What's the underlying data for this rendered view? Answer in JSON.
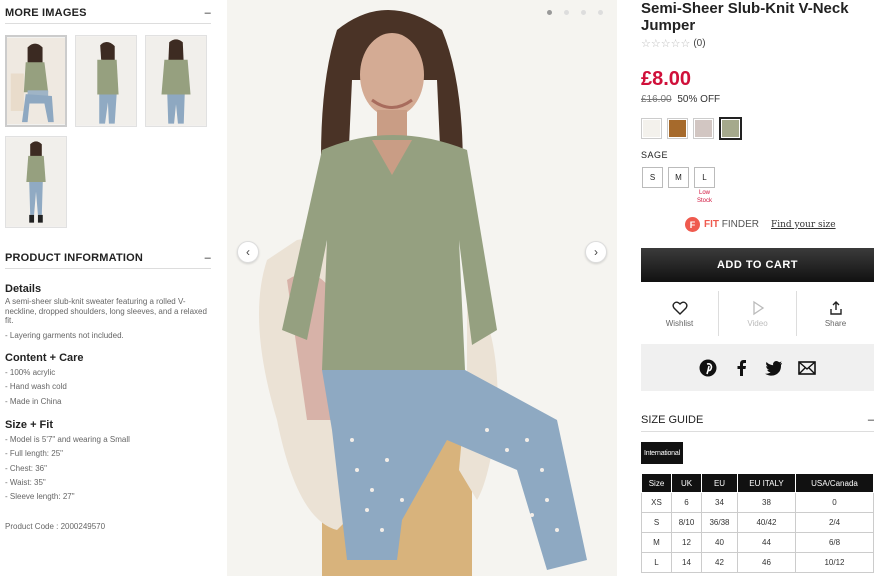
{
  "sidebar": {
    "more_images_title": "MORE IMAGES",
    "more_images_toggle": "–",
    "product_info_title": "PRODUCT INFORMATION",
    "product_info_toggle": "–",
    "details_heading": "Details",
    "details_text": "A semi-sheer slub-knit sweater featuring a rolled V-neckline, dropped shoulders, long sleeves, and a relaxed fit.",
    "details_note": "- Layering garments not included.",
    "content_heading": "Content + Care",
    "content_items": [
      "- 100% acrylic",
      "- Hand wash cold",
      "- Made in China"
    ],
    "fit_heading": "Size + Fit",
    "fit_items": [
      "- Model is 5'7\" and wearing a Small",
      "- Full length: 25\"",
      "- Chest: 36\"",
      "- Waist: 35\"",
      "- Sleeve length: 27\""
    ],
    "product_code": "Product Code : 2000249570"
  },
  "product": {
    "title": "Semi-Sheer Slub-Knit V-Neck Jumper",
    "rating_stars": "☆☆☆☆☆",
    "review_count": "(0)",
    "price": "£8.00",
    "old_price": "£16.00",
    "discount": "50% OFF",
    "swatch_colors": [
      "#f3f1ec",
      "#a66a2c",
      "#d2c6c2",
      "#a5a98c"
    ],
    "color_name": "SAGE",
    "sizes": [
      "S",
      "M",
      "L"
    ],
    "low_stock_label": [
      "Low",
      "Stock"
    ],
    "fit_finder_icon": "F",
    "fit_finder_brand": "FIT",
    "fit_finder_word": " FINDER",
    "fit_finder_link": "Find your size",
    "add_to_cart": "ADD TO CART",
    "actions": [
      "Wishlist",
      "Video",
      "Share"
    ],
    "accent": "#d0103a"
  },
  "size_guide": {
    "title": "SIZE GUIDE",
    "toggle": "–",
    "tab": "International",
    "headers": [
      "Size",
      "UK",
      "EU",
      "EU ITALY",
      "USA/Canada"
    ],
    "rows": [
      [
        "XS",
        "6",
        "34",
        "38",
        "0"
      ],
      [
        "S",
        "8/10",
        "36/38",
        "40/42",
        "2/4"
      ],
      [
        "M",
        "12",
        "40",
        "44",
        "6/8"
      ],
      [
        "L",
        "14",
        "42",
        "46",
        "10/12"
      ]
    ]
  },
  "carousel": {
    "prev_arrow": "‹",
    "next_arrow": "›"
  }
}
